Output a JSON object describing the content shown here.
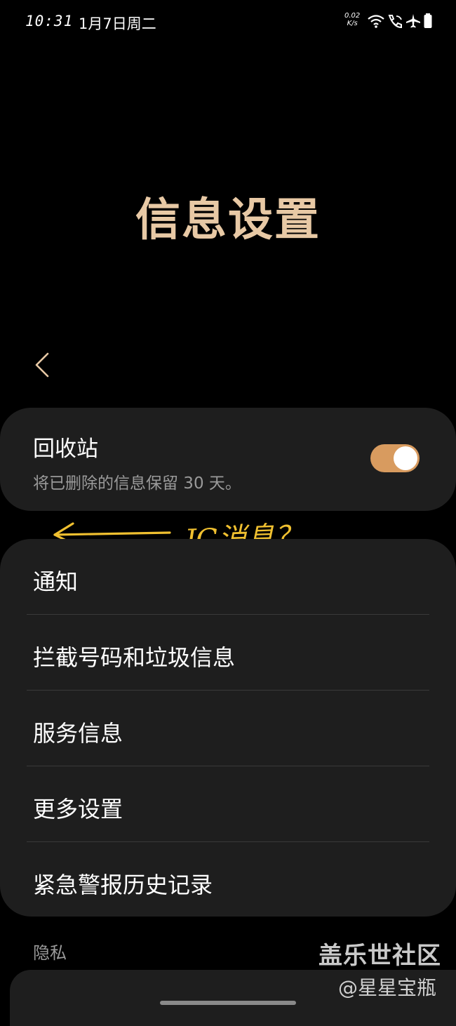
{
  "status_bar": {
    "time": "10:31",
    "date": "1月7日周二",
    "speed_top": "0.02",
    "speed_bottom": "K/s",
    "icons": [
      "wifi-icon",
      "call-wifi-icon",
      "airplane-icon",
      "battery-icon"
    ]
  },
  "header": {
    "title": "信息设置",
    "back_icon": "chevron-left-icon"
  },
  "recycle_bin": {
    "title": "回收站",
    "subtitle": "将已删除的信息保留 30 天。",
    "toggle_on": true
  },
  "annotation": {
    "text": "JG消息？"
  },
  "menu": {
    "items": [
      {
        "label": "通知"
      },
      {
        "label": "拦截号码和垃圾信息"
      },
      {
        "label": "服务信息"
      },
      {
        "label": "更多设置"
      },
      {
        "label": "紧急警报历史记录"
      }
    ]
  },
  "privacy": {
    "label": "隐私"
  },
  "watermark": {
    "brand": "盖乐世社区",
    "user": "@星星宝瓶"
  },
  "colors": {
    "title": "#e8c9a5",
    "toggle": "#d89b5f",
    "card_bg": "#1e1e1e",
    "annotation": "#f0c030"
  }
}
